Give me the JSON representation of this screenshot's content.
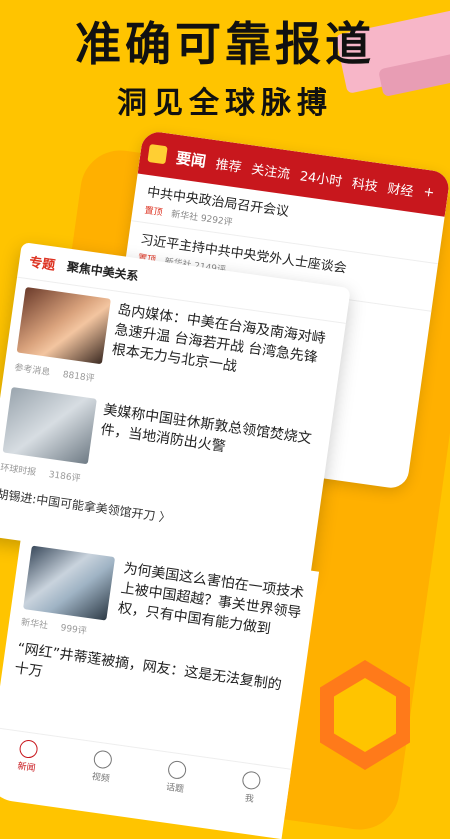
{
  "hero": {
    "title": "准确可靠报道",
    "subtitle": "洞见全球脉搏"
  },
  "back_screen": {
    "tabs": [
      "要闻",
      "推荐",
      "关注流",
      "24小时",
      "科技",
      "财经",
      "+"
    ],
    "items": [
      {
        "headline": "中共中央政治局召开会议",
        "tag": "置顶",
        "source": "新华社",
        "comments": "9292评"
      },
      {
        "headline": "习近平主持中共中央党外人士座谈会",
        "tag": "置顶",
        "source": "新华社",
        "comments": "2149评"
      }
    ]
  },
  "topic_card": {
    "tag": "专题",
    "title": "聚焦中美关系",
    "items": [
      {
        "headline": "岛内媒体：中美在台海及南海对峙急速升温 台海若开战 台湾急先锋根本无力与北京一战",
        "source": "参考消息",
        "comments": "8818评"
      },
      {
        "headline": "美媒称中国驻休斯敦总领馆焚烧文件，当地消防出火警",
        "source": "环球时报",
        "comments": "3186评"
      }
    ],
    "link": "胡锡进:中国可能拿美领馆开刀 〉"
  },
  "front_screen": {
    "item": {
      "headline": "为何美国这么害怕在一项技术上被中国超越？事关世界领导权，只有中国有能力做到",
      "source": "新华社",
      "comments": "999评"
    },
    "line": "“网红”井蒂莲被摘，网友：这是无法复制的十万",
    "nav": [
      {
        "label": "新闻",
        "icon": "news-icon",
        "active": true
      },
      {
        "label": "视频",
        "icon": "video-icon",
        "active": false
      },
      {
        "label": "话题",
        "icon": "topic-icon",
        "active": false
      },
      {
        "label": "我",
        "icon": "profile-icon",
        "active": false
      }
    ]
  },
  "colors": {
    "brand_red": "#c8171d",
    "background": "#ffc400"
  }
}
